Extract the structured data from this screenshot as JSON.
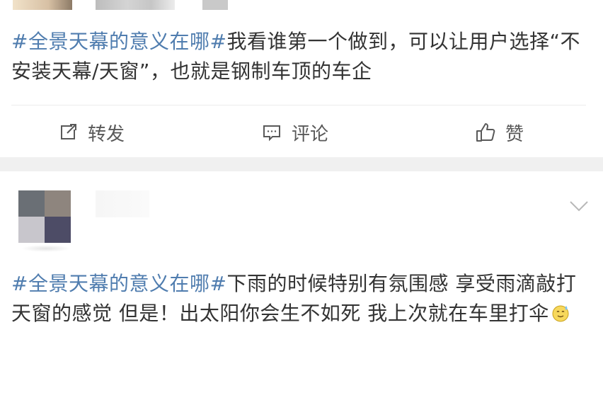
{
  "post1": {
    "hashtag": "#全景天幕的意义在哪#",
    "text": "我看谁第一个做到，可以让用户选择“不安装天幕/天窗”，也就是钢制车顶的车企",
    "actions": {
      "repost": "转发",
      "comment": "评论",
      "like": "赞"
    }
  },
  "post2": {
    "hashtag": "#全景天幕的意义在哪#",
    "text": "下雨的时候特别有氛围感 享受雨滴敲打天窗的感觉 但是！出太阳你会生不如死 我上次就在车里打伞",
    "emoji": "sweat-smile-emoji"
  },
  "icons": {
    "repost": "share-edit-icon",
    "comment": "comment-bubble-icon",
    "like": "thumbs-up-icon",
    "menu": "chevron-down-icon"
  },
  "colors": {
    "hashtag": "#507daf",
    "text": "#333333",
    "action": "#595959",
    "separator": "#f0f0f0"
  }
}
